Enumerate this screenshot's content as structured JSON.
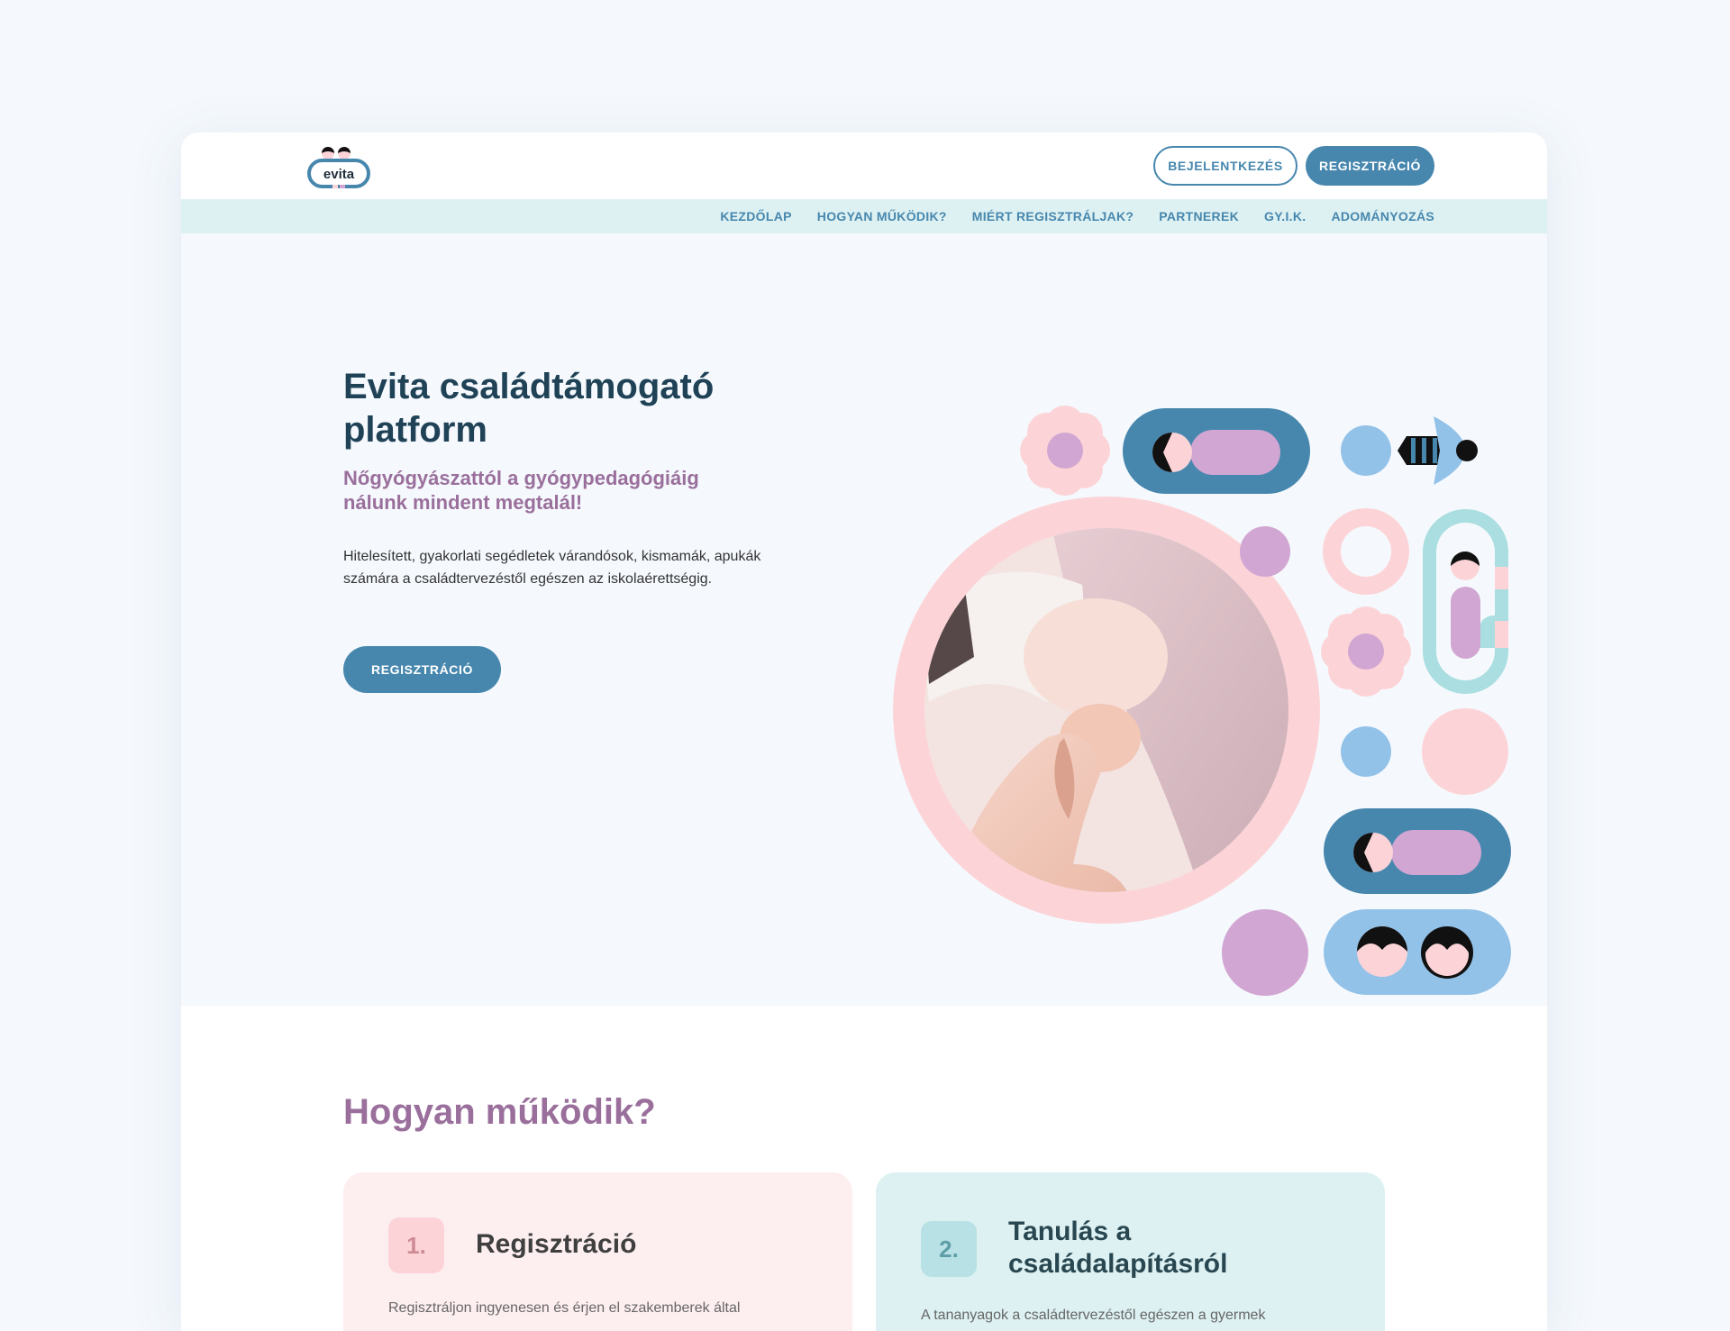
{
  "brand": {
    "logo_text": "evita"
  },
  "header": {
    "login_label": "BEJELENTKEZÉS",
    "register_label": "REGISZTRÁCIÓ"
  },
  "nav": {
    "items": [
      "KEZDŐLAP",
      "HOGYAN MŰKÖDIK?",
      "MIÉRT REGISZTRÁLJAK?",
      "PARTNEREK",
      "GY.I.K.",
      "ADOMÁNYOZÁS"
    ]
  },
  "hero": {
    "title": "Evita családtámogató platform",
    "subtitle": "Nőgyógyászattól a gyógypedagógiáig nálunk mindent megtalál!",
    "body": "Hitelesített, gyakorlati segédletek várandósok, kismamák, apukák számára a családtervezéstől egészen az iskolaérettségig.",
    "cta_label": "REGISZTRÁCIÓ"
  },
  "how": {
    "title": "Hogyan működik?",
    "cards": [
      {
        "num": "1.",
        "title": "Regisztráció",
        "text": "Regisztráljon ingyenesen és érjen el szakemberek által"
      },
      {
        "num": "2.",
        "title": "Tanulás a családalapításról",
        "text": "A tananyagok a családtervezéstől egészen a gyermek"
      }
    ]
  },
  "colors": {
    "accent": "#4787ae",
    "nav_bg": "#ddf1f2",
    "pink": "#fcd4d8",
    "lilac": "#d1a6d2",
    "sky": "#93c2e9",
    "teal": "#aadee0",
    "purple_text": "#9a6f9c",
    "dark_text": "#1f4256"
  }
}
